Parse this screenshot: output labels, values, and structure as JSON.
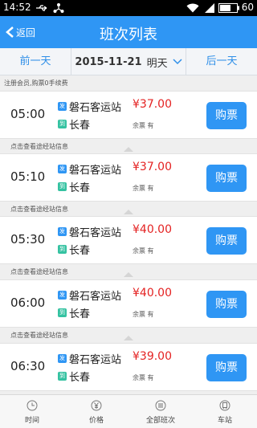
{
  "status_bar": {
    "time": "14:52",
    "battery": "60"
  },
  "header": {
    "back_label": "返回",
    "title": "班次列表"
  },
  "date_nav": {
    "prev": "前一天",
    "date": "2015-11-21",
    "day": "明天",
    "next": "后一天"
  },
  "notice": "注册会员,购票0手续费",
  "route_info_link": "点击查看途经站信息",
  "tag_from": "发",
  "tag_to": "到",
  "seats_label": "余票 有",
  "buy_label": "购票",
  "trips": [
    {
      "time": "05:00",
      "from": "磐石客运站",
      "to": "长春",
      "price": "¥37.00"
    },
    {
      "time": "05:10",
      "from": "磐石客运站",
      "to": "长春",
      "price": "¥37.00"
    },
    {
      "time": "05:30",
      "from": "磐石客运站",
      "to": "长春",
      "price": "¥40.00"
    },
    {
      "time": "06:00",
      "from": "磐石客运站",
      "to": "长春",
      "price": "¥40.00"
    },
    {
      "time": "06:30",
      "from": "磐石客运站",
      "to": "长春",
      "price": "¥39.00"
    }
  ],
  "tabs": [
    {
      "label": "时间",
      "icon": "clock-icon"
    },
    {
      "label": "价格",
      "icon": "yen-icon"
    },
    {
      "label": "全部班次",
      "icon": "list-icon"
    },
    {
      "label": "车站",
      "icon": "station-icon"
    }
  ],
  "colors": {
    "primary": "#2f96f4",
    "price": "#e42222",
    "to_tag": "#34c2a1"
  }
}
